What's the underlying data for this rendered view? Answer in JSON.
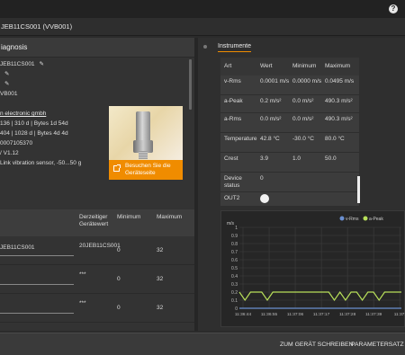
{
  "topbar": {
    "help_icon": "?"
  },
  "breadcrumb": "JEB11CS001 (VVB001)",
  "left": {
    "title": "iagnosis",
    "info": [
      {
        "text": "JEB11CS001",
        "edit": true
      },
      {
        "text": "",
        "edit": true
      },
      {
        "text": "",
        "edit": true
      },
      {
        "text": "VB001",
        "edit": false
      },
      {
        "text": "",
        "edit": false
      },
      {
        "text": "n electronic gmbh",
        "edit": false,
        "link": true
      },
      {
        "text": "136 | 310 d | Bytes 1d 54d",
        "edit": false
      },
      {
        "text": "404 | 1028 d | Bytes 4d 4d",
        "edit": false
      },
      {
        "text": "0007105370",
        "edit": false
      },
      {
        "text": "/ V1.12",
        "edit": false
      },
      {
        "text": "Link vibration sensor, -50...50 g",
        "edit": false
      }
    ],
    "visit_button": "Besuchen Sie die Geräteseite",
    "table": {
      "headers": {
        "current": "Derzeitiger Gerätewert",
        "minimum": "Minimum",
        "maximum": "Maximum"
      },
      "rows": [
        {
          "field": "JEB11CS001",
          "current": "20JEB11CS001",
          "minimum": "0",
          "maximum": "32"
        },
        {
          "field": "",
          "current": "***",
          "minimum": "0",
          "maximum": "32"
        },
        {
          "field": "",
          "current": "***",
          "minimum": "0",
          "maximum": "32"
        }
      ]
    }
  },
  "right": {
    "tab": "Instrumente",
    "table": {
      "headers": [
        "Art",
        "Wert",
        "Minimum",
        "Maximum"
      ],
      "rows": [
        {
          "art": "v-Rms",
          "wert": "0.0001 m/s",
          "min": "0.0000 m/s",
          "max": "0.0495 m/s"
        },
        {
          "art": "a-Peak",
          "wert": "0.2 m/s²",
          "min": "0.0 m/s²",
          "max": "490.3 m/s²"
        },
        {
          "art": "a-Rms",
          "wert": "0.0 m/s²",
          "min": "0.0 m/s²",
          "max": "490.3 m/s²"
        },
        {
          "art": "Temperature",
          "wert": "42.8 °C",
          "min": "-30.0 °C",
          "max": "80.0 °C"
        },
        {
          "art": "Crest",
          "wert": "3.9",
          "min": "1.0",
          "max": "50.0"
        },
        {
          "art": "Device status",
          "wert": "0",
          "min": "",
          "max": ""
        },
        {
          "art": "OUT2",
          "wert": "",
          "min": "",
          "max": ""
        }
      ]
    }
  },
  "chart_data": {
    "type": "line",
    "ylabel": "m/s",
    "legend": [
      "v-Rms",
      "a-Peak"
    ],
    "legend_position": "top-right",
    "ylim": [
      0,
      1
    ],
    "y_ticks": [
      "1",
      "0.9",
      "0.8",
      "0.7",
      "0.6",
      "0.5",
      "0.4",
      "0.3",
      "0.2",
      "0.1",
      "0"
    ],
    "x_ticks": [
      "11:36:44",
      "11:36:55",
      "11:37:06",
      "11:37:17",
      "11:37:28",
      "11:37:39",
      "11:37:"
    ],
    "series": [
      {
        "name": "v-Rms",
        "color": "#6a8fd0",
        "values": [
          0.0,
          0.0,
          0.0,
          0.0,
          0.0,
          0.0,
          0.0,
          0.0,
          0.0,
          0.0,
          0.0,
          0.0,
          0.0,
          0.0,
          0.0,
          0.0,
          0.0,
          0.0,
          0.0,
          0.0,
          0.0,
          0.0,
          0.0,
          0.0,
          0.0,
          0.0,
          0.0,
          0.0,
          0.0,
          0.0
        ]
      },
      {
        "name": "a-Peak",
        "color": "#b8e05a",
        "values": [
          0.2,
          0.1,
          0.2,
          0.2,
          0.2,
          0.1,
          0.2,
          0.2,
          0.2,
          0.2,
          0.2,
          0.2,
          0.2,
          0.2,
          0.2,
          0.2,
          0.2,
          0.1,
          0.2,
          0.1,
          0.2,
          0.2,
          0.1,
          0.2,
          0.2,
          0.1,
          0.2,
          0.2,
          0.2,
          0.2
        ]
      }
    ]
  },
  "bottom": {
    "write_button": "ZUM GERÄT SCHREIBEN",
    "params_button": "PARAMETERSATZ SPE"
  }
}
